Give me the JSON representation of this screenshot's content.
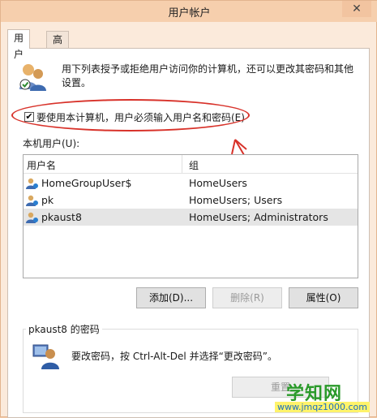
{
  "window": {
    "title": "用户帐户",
    "close_glyph": "✕"
  },
  "tabs": [
    {
      "label": "用户",
      "active": true
    },
    {
      "label": "高级",
      "active": false
    }
  ],
  "description": "用下列表授予或拒绝用户访问你的计算机，还可以更改其密码和其他设置。",
  "require_login": {
    "label": "要使用本计算机，用户必须输入用户名和密码(E)",
    "checked": true,
    "check_glyph": "✔"
  },
  "users_section": {
    "label": "本机用户(U):",
    "columns": {
      "name": "用户名",
      "group": "组"
    },
    "rows": [
      {
        "name": "HomeGroupUser$",
        "group": "HomeUsers",
        "selected": false
      },
      {
        "name": "pk",
        "group": "HomeUsers; Users",
        "selected": false
      },
      {
        "name": "pkaust8",
        "group": "HomeUsers; Administrators",
        "selected": true
      }
    ]
  },
  "buttons": {
    "add": "添加(D)...",
    "remove": "删除(R)",
    "properties": "属性(O)"
  },
  "password_group": {
    "title": "pkaust8 的密码",
    "text": "要改密码，按 Ctrl-Alt-Del 并选择“更改密码”。",
    "reset_button": "重置"
  },
  "watermark": {
    "main": "学知网",
    "url": "www.jmqz1000.com"
  },
  "colors": {
    "title_bar": "#f6cfad",
    "annotation": "#d8322a",
    "selected_row": "#e5e5e5"
  },
  "icons": {
    "users": "users-icon",
    "user_row": "user-icon",
    "password_user": "user-password-icon"
  }
}
